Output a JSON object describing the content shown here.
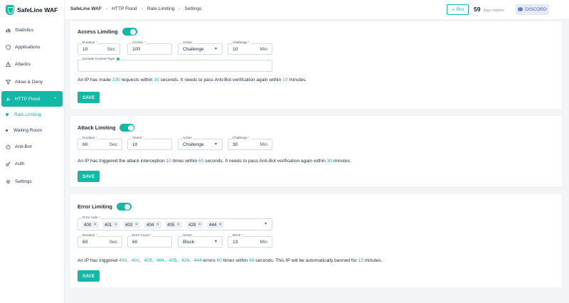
{
  "app": {
    "name": "SafeLine WAF"
  },
  "sidebar": {
    "items": [
      {
        "label": "Statistics",
        "icon": "bar-chart-icon"
      },
      {
        "label": "Applications",
        "icon": "shield-icon"
      },
      {
        "label": "Attacks",
        "icon": "alert-icon"
      },
      {
        "label": "Allow & Deny",
        "icon": "filter-icon"
      },
      {
        "label": "HTTP Flood",
        "icon": "wrench-icon",
        "active": true
      },
      {
        "label": "Anti-Bot",
        "icon": "bot-icon"
      },
      {
        "label": "Auth",
        "icon": "key-icon"
      },
      {
        "label": "Settings",
        "icon": "gear-icon"
      }
    ],
    "subitems": [
      {
        "label": "Rate Limiting",
        "active": true
      },
      {
        "label": "Waiting Room"
      }
    ]
  },
  "breadcrumb": [
    "SafeLine WAF",
    "HTTP Flood",
    "Rate Limiting",
    "Settings"
  ],
  "header": {
    "pro_label": "Pro",
    "days_value": "59",
    "days_label": "days expires",
    "discord_label": "DISCORD"
  },
  "access": {
    "title": "Access Limiting",
    "enabled": true,
    "duration": {
      "label": "Duration",
      "value": "10",
      "unit": "Sec"
    },
    "access": {
      "label": "Access",
      "value": "100"
    },
    "action": {
      "label": "Action",
      "value": "Challenge"
    },
    "challenge": {
      "label": "Challenge",
      "value": "10",
      "unit": "Min"
    },
    "exclude": {
      "label": "Exclude Content-Type",
      "value": ""
    },
    "desc": {
      "p1": "An IP has made ",
      "v1": "100",
      "p2": " requests within ",
      "v2": "10",
      "p3": " seconds. It needs to pass Anti-Bot verification again within ",
      "v3": "10",
      "p4": " minutes."
    },
    "save_label": "SAVE"
  },
  "attack": {
    "title": "Attack Limiting",
    "enabled": true,
    "duration": {
      "label": "Duration",
      "value": "60",
      "unit": "Sec"
    },
    "attack": {
      "label": "Attack",
      "value": "10"
    },
    "action": {
      "label": "Action",
      "value": "Challenge"
    },
    "challenge": {
      "label": "Challenge",
      "value": "30",
      "unit": "Min"
    },
    "desc": {
      "p1": "An IP has triggered the attack interception ",
      "v1": "10",
      "p2": " times within ",
      "v2": "60",
      "p3": " seconds. It needs to pass Anti-Bot verification again within ",
      "v3": "30",
      "p4": " minutes."
    },
    "save_label": "SAVE"
  },
  "error": {
    "title": "Error Limiting",
    "enabled": true,
    "codes": {
      "label": "Error code",
      "values": [
        "400",
        "401",
        "403",
        "404",
        "405",
        "429",
        "444"
      ]
    },
    "duration": {
      "label": "Duration",
      "value": "60",
      "unit": "Sec"
    },
    "count": {
      "label": "Error Count",
      "value": "60"
    },
    "action": {
      "label": "Action",
      "value": "Block"
    },
    "block": {
      "label": "Block",
      "value": "13",
      "unit": "Min"
    },
    "desc": {
      "p1": "An IP has triggered ",
      "v1": "400、401、403、404、405、429、444",
      "p2": " errors ",
      "v2": "60",
      "p3": " times within ",
      "v3": "60",
      "p4": " seconds. This IP will be automatically banned for ",
      "v4": "13",
      "p5": " minutes."
    },
    "save_label": "SAVE"
  }
}
